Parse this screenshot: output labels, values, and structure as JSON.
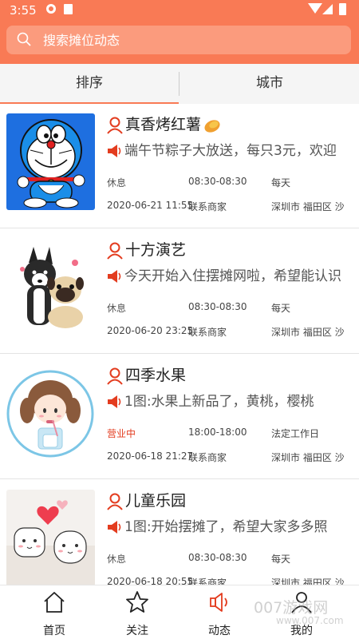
{
  "status_bar": {
    "time": "3:55"
  },
  "search": {
    "placeholder": "搜索摊位动态"
  },
  "tabs": [
    {
      "label": "排序"
    },
    {
      "label": "城市"
    }
  ],
  "colors": {
    "accent": "#f97a55",
    "status_open": "#e33c1f"
  },
  "items": [
    {
      "title": "真香烤红薯",
      "message": "端午节粽子大放送，每只3元，欢迎",
      "status": "休息",
      "hours": "08:30-08:30",
      "days": "每天",
      "datetime": "2020-06-21 11:55",
      "contact": "联系商家",
      "location": "深圳市 福田区 沙"
    },
    {
      "title": "十方演艺",
      "message": "今天开始入住摆摊网啦，希望能认识",
      "status": "休息",
      "hours": "08:30-08:30",
      "days": "每天",
      "datetime": "2020-06-20 23:25",
      "contact": "联系商家",
      "location": "深圳市 福田区 沙"
    },
    {
      "title": "四季水果",
      "message": "1图:水果上新品了，黄桃，樱桃",
      "status": "营业中",
      "hours": "18:00-18:00",
      "days": "法定工作日",
      "datetime": "2020-06-18 21:27",
      "contact": "联系商家",
      "location": "深圳市 福田区 沙"
    },
    {
      "title": "儿童乐园",
      "message": "1图:开始摆摊了，希望大家多多照",
      "status": "休息",
      "hours": "08:30-08:30",
      "days": "每天",
      "datetime": "2020-06-18 20:55",
      "contact": "联系商家",
      "location": "深圳市 福田区 沙"
    }
  ],
  "bottom_nav": [
    {
      "label": "首页",
      "icon": "home-icon"
    },
    {
      "label": "关注",
      "icon": "star-icon"
    },
    {
      "label": "动态",
      "icon": "speaker-icon"
    },
    {
      "label": "我的",
      "icon": "user-icon"
    }
  ],
  "watermark": {
    "text": "007游戏网",
    "sub": "www.007.com"
  }
}
